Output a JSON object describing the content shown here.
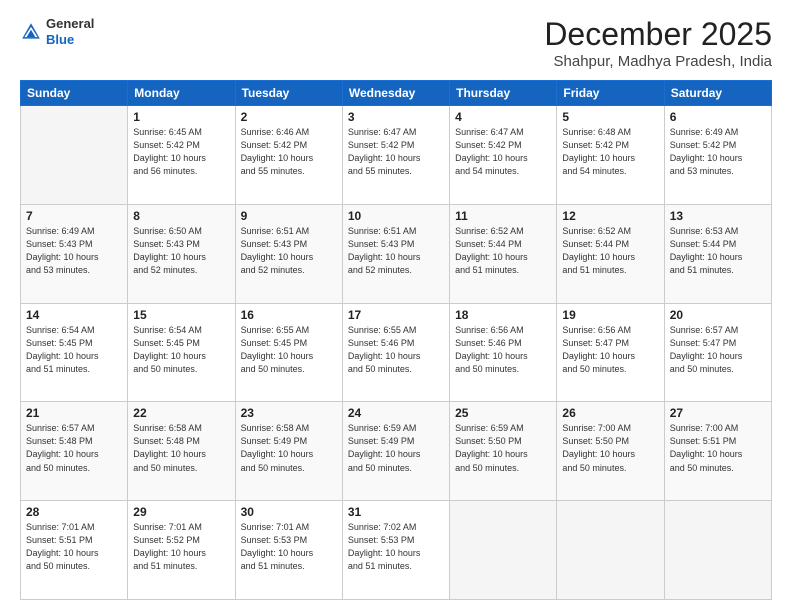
{
  "header": {
    "logo_line1": "General",
    "logo_line2": "Blue",
    "month_title": "December 2025",
    "location": "Shahpur, Madhya Pradesh, India"
  },
  "days_of_week": [
    "Sunday",
    "Monday",
    "Tuesday",
    "Wednesday",
    "Thursday",
    "Friday",
    "Saturday"
  ],
  "weeks": [
    [
      {
        "day": "",
        "info": ""
      },
      {
        "day": "1",
        "info": "Sunrise: 6:45 AM\nSunset: 5:42 PM\nDaylight: 10 hours\nand 56 minutes."
      },
      {
        "day": "2",
        "info": "Sunrise: 6:46 AM\nSunset: 5:42 PM\nDaylight: 10 hours\nand 55 minutes."
      },
      {
        "day": "3",
        "info": "Sunrise: 6:47 AM\nSunset: 5:42 PM\nDaylight: 10 hours\nand 55 minutes."
      },
      {
        "day": "4",
        "info": "Sunrise: 6:47 AM\nSunset: 5:42 PM\nDaylight: 10 hours\nand 54 minutes."
      },
      {
        "day": "5",
        "info": "Sunrise: 6:48 AM\nSunset: 5:42 PM\nDaylight: 10 hours\nand 54 minutes."
      },
      {
        "day": "6",
        "info": "Sunrise: 6:49 AM\nSunset: 5:42 PM\nDaylight: 10 hours\nand 53 minutes."
      }
    ],
    [
      {
        "day": "7",
        "info": "Sunrise: 6:49 AM\nSunset: 5:43 PM\nDaylight: 10 hours\nand 53 minutes."
      },
      {
        "day": "8",
        "info": "Sunrise: 6:50 AM\nSunset: 5:43 PM\nDaylight: 10 hours\nand 52 minutes."
      },
      {
        "day": "9",
        "info": "Sunrise: 6:51 AM\nSunset: 5:43 PM\nDaylight: 10 hours\nand 52 minutes."
      },
      {
        "day": "10",
        "info": "Sunrise: 6:51 AM\nSunset: 5:43 PM\nDaylight: 10 hours\nand 52 minutes."
      },
      {
        "day": "11",
        "info": "Sunrise: 6:52 AM\nSunset: 5:44 PM\nDaylight: 10 hours\nand 51 minutes."
      },
      {
        "day": "12",
        "info": "Sunrise: 6:52 AM\nSunset: 5:44 PM\nDaylight: 10 hours\nand 51 minutes."
      },
      {
        "day": "13",
        "info": "Sunrise: 6:53 AM\nSunset: 5:44 PM\nDaylight: 10 hours\nand 51 minutes."
      }
    ],
    [
      {
        "day": "14",
        "info": "Sunrise: 6:54 AM\nSunset: 5:45 PM\nDaylight: 10 hours\nand 51 minutes."
      },
      {
        "day": "15",
        "info": "Sunrise: 6:54 AM\nSunset: 5:45 PM\nDaylight: 10 hours\nand 50 minutes."
      },
      {
        "day": "16",
        "info": "Sunrise: 6:55 AM\nSunset: 5:45 PM\nDaylight: 10 hours\nand 50 minutes."
      },
      {
        "day": "17",
        "info": "Sunrise: 6:55 AM\nSunset: 5:46 PM\nDaylight: 10 hours\nand 50 minutes."
      },
      {
        "day": "18",
        "info": "Sunrise: 6:56 AM\nSunset: 5:46 PM\nDaylight: 10 hours\nand 50 minutes."
      },
      {
        "day": "19",
        "info": "Sunrise: 6:56 AM\nSunset: 5:47 PM\nDaylight: 10 hours\nand 50 minutes."
      },
      {
        "day": "20",
        "info": "Sunrise: 6:57 AM\nSunset: 5:47 PM\nDaylight: 10 hours\nand 50 minutes."
      }
    ],
    [
      {
        "day": "21",
        "info": "Sunrise: 6:57 AM\nSunset: 5:48 PM\nDaylight: 10 hours\nand 50 minutes."
      },
      {
        "day": "22",
        "info": "Sunrise: 6:58 AM\nSunset: 5:48 PM\nDaylight: 10 hours\nand 50 minutes."
      },
      {
        "day": "23",
        "info": "Sunrise: 6:58 AM\nSunset: 5:49 PM\nDaylight: 10 hours\nand 50 minutes."
      },
      {
        "day": "24",
        "info": "Sunrise: 6:59 AM\nSunset: 5:49 PM\nDaylight: 10 hours\nand 50 minutes."
      },
      {
        "day": "25",
        "info": "Sunrise: 6:59 AM\nSunset: 5:50 PM\nDaylight: 10 hours\nand 50 minutes."
      },
      {
        "day": "26",
        "info": "Sunrise: 7:00 AM\nSunset: 5:50 PM\nDaylight: 10 hours\nand 50 minutes."
      },
      {
        "day": "27",
        "info": "Sunrise: 7:00 AM\nSunset: 5:51 PM\nDaylight: 10 hours\nand 50 minutes."
      }
    ],
    [
      {
        "day": "28",
        "info": "Sunrise: 7:01 AM\nSunset: 5:51 PM\nDaylight: 10 hours\nand 50 minutes."
      },
      {
        "day": "29",
        "info": "Sunrise: 7:01 AM\nSunset: 5:52 PM\nDaylight: 10 hours\nand 51 minutes."
      },
      {
        "day": "30",
        "info": "Sunrise: 7:01 AM\nSunset: 5:53 PM\nDaylight: 10 hours\nand 51 minutes."
      },
      {
        "day": "31",
        "info": "Sunrise: 7:02 AM\nSunset: 5:53 PM\nDaylight: 10 hours\nand 51 minutes."
      },
      {
        "day": "",
        "info": ""
      },
      {
        "day": "",
        "info": ""
      },
      {
        "day": "",
        "info": ""
      }
    ]
  ]
}
